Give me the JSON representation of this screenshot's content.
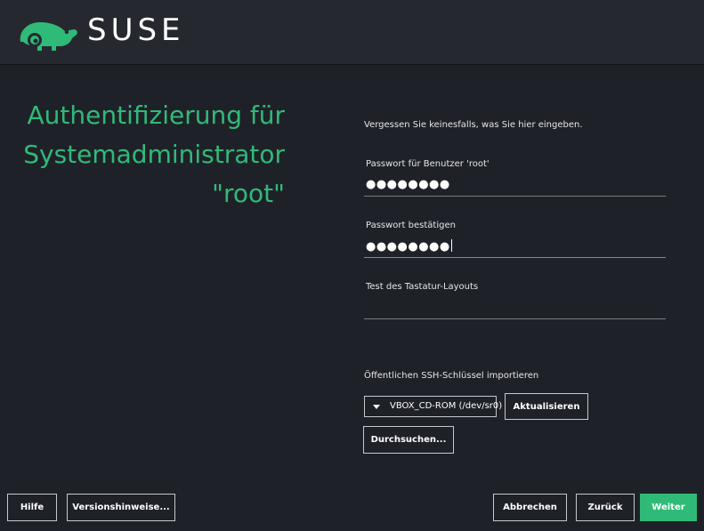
{
  "header": {
    "brand": "SUSE",
    "logo_icon": "suse-chameleon-icon"
  },
  "title": {
    "lines": [
      "Authentifizierung für",
      "Systemadministrator",
      "\"root\""
    ],
    "color": "#30ba78"
  },
  "form": {
    "hint": "Vergessen Sie keinesfalls, was Sie hier eingeben.",
    "password": {
      "label": "Passwort für Benutzer 'root'",
      "value": "●●●●●●●●"
    },
    "confirm": {
      "label": "Passwort bestätigen",
      "value": "●●●●●●●●"
    },
    "keyboard_test": {
      "label": "Test des Tastatur-Layouts",
      "value": ""
    },
    "ssh": {
      "label": "Öffentlichen SSH-Schlüssel importieren",
      "device": "VBOX_CD-ROM (/dev/sr0)",
      "refresh": "Aktualisieren",
      "browse": "Durchsuchen..."
    }
  },
  "footer": {
    "help": "Hilfe",
    "release_notes": "Versionshinweise...",
    "abort": "Abbrechen",
    "back": "Zurück",
    "next": "Weiter"
  },
  "colors": {
    "accent": "#30ba78",
    "background": "#1f2129",
    "header": "#26282f"
  }
}
